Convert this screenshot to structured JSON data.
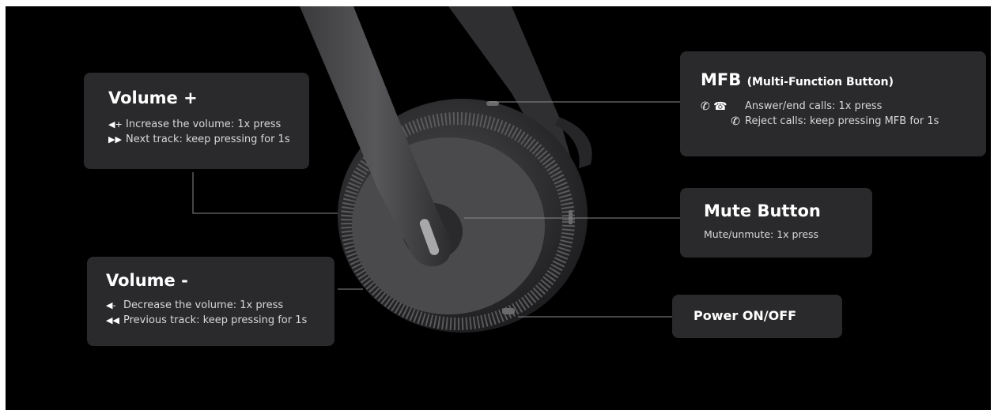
{
  "callouts": {
    "volume_up": {
      "title": "Volume +",
      "items": [
        {
          "icon": "volume-up-icon",
          "glyph": "◀+",
          "text": "Increase the volume: 1x press"
        },
        {
          "icon": "next-track-icon",
          "glyph": "▶▶",
          "text": "Next track: keep pressing for 1s"
        }
      ]
    },
    "volume_down": {
      "title": "Volume -",
      "items": [
        {
          "icon": "volume-down-icon",
          "glyph": "◀-",
          "text": "Decrease the volume: 1x press"
        },
        {
          "icon": "previous-track-icon",
          "glyph": "◀◀",
          "text": "Previous track: keep pressing for 1s"
        }
      ]
    },
    "mfb": {
      "title": "MFB",
      "subtitle": "(Multi-Function Button)",
      "items": [
        {
          "icon": "phone-answer-end-icon",
          "glyph": "✆ ☎",
          "text": "Answer/end calls: 1x press"
        },
        {
          "icon": "phone-reject-icon",
          "glyph": "✆",
          "text": "Reject calls: keep pressing MFB for 1s"
        }
      ]
    },
    "mute": {
      "title": "Mute Button",
      "text": "Mute/unmute: 1x press"
    },
    "power": {
      "title": "Power ON/OFF"
    }
  },
  "colors": {
    "background": "#000000",
    "card": "#2a2a2c",
    "leader_line": "#8a8a8a"
  }
}
